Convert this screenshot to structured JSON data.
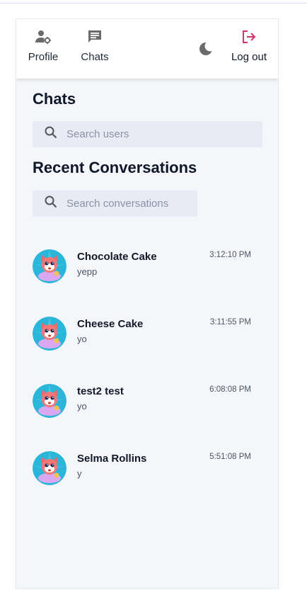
{
  "header": {
    "profile_label": "Profile",
    "chats_label": "Chats",
    "logout_label": "Log out",
    "accent_color": "#d6336c"
  },
  "chats_section": {
    "title": "Chats",
    "search_placeholder": "Search users"
  },
  "recent_section": {
    "title": "Recent Conversations",
    "search_placeholder": "Search conversations"
  },
  "conversations": [
    {
      "name": "Chocolate Cake",
      "last_message": "yepp",
      "time": "3:12:10 PM"
    },
    {
      "name": "Cheese Cake",
      "last_message": "yo",
      "time": "3:11:55 PM"
    },
    {
      "name": "test2 test",
      "last_message": "yo",
      "time": "6:08:08 PM"
    },
    {
      "name": "Selma Rollins",
      "last_message": "y",
      "time": "5:51:08 PM"
    }
  ]
}
